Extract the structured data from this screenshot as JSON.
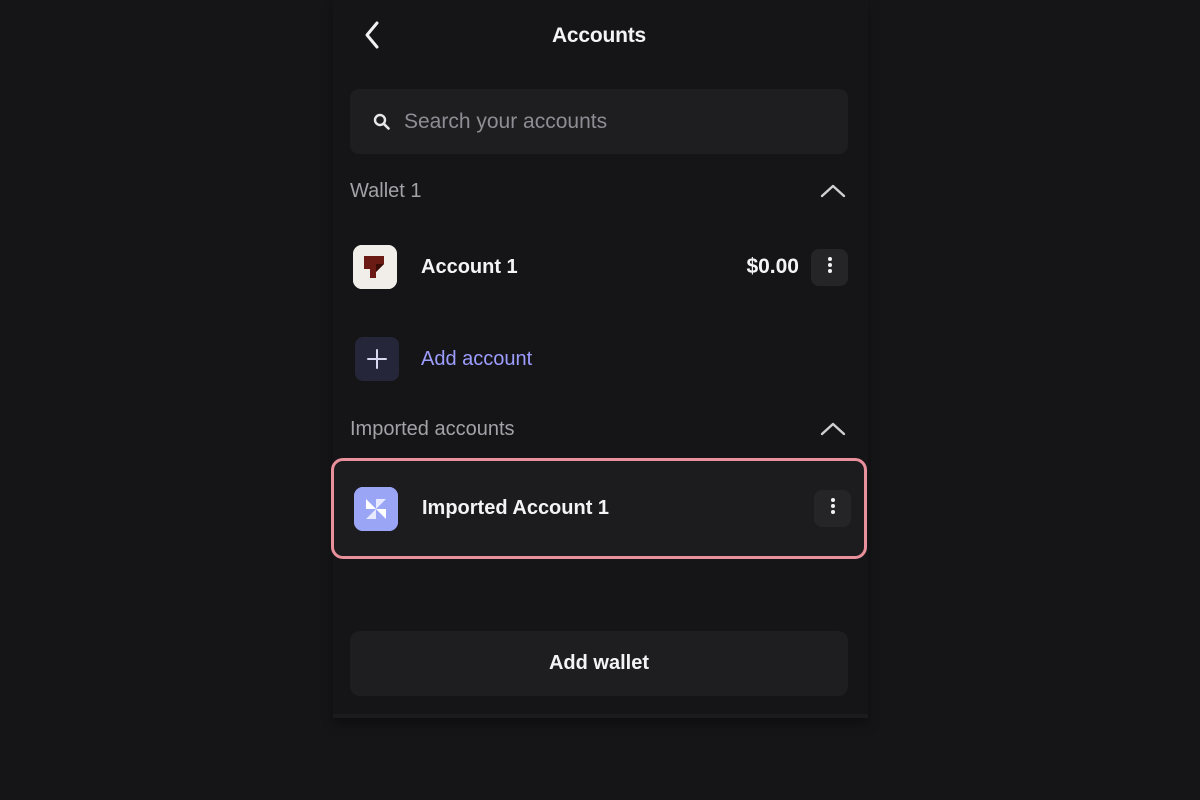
{
  "header": {
    "title": "Accounts",
    "back_icon": "chevron-left-icon"
  },
  "search": {
    "placeholder": "Search your accounts",
    "value": ""
  },
  "sections": [
    {
      "label": "Wallet 1",
      "expanded": true,
      "accounts": [
        {
          "name": "Account 1",
          "balance": "$0.00"
        }
      ],
      "add_account_label": "Add account"
    },
    {
      "label": "Imported accounts",
      "expanded": true,
      "accounts": [
        {
          "name": "Imported Account 1",
          "balance": ""
        }
      ]
    }
  ],
  "footer": {
    "add_wallet_label": "Add wallet"
  },
  "colors": {
    "background": "#151517",
    "surface": "#1e1e21",
    "accent": "#9d9dff",
    "highlight_border": "#e8909c"
  }
}
